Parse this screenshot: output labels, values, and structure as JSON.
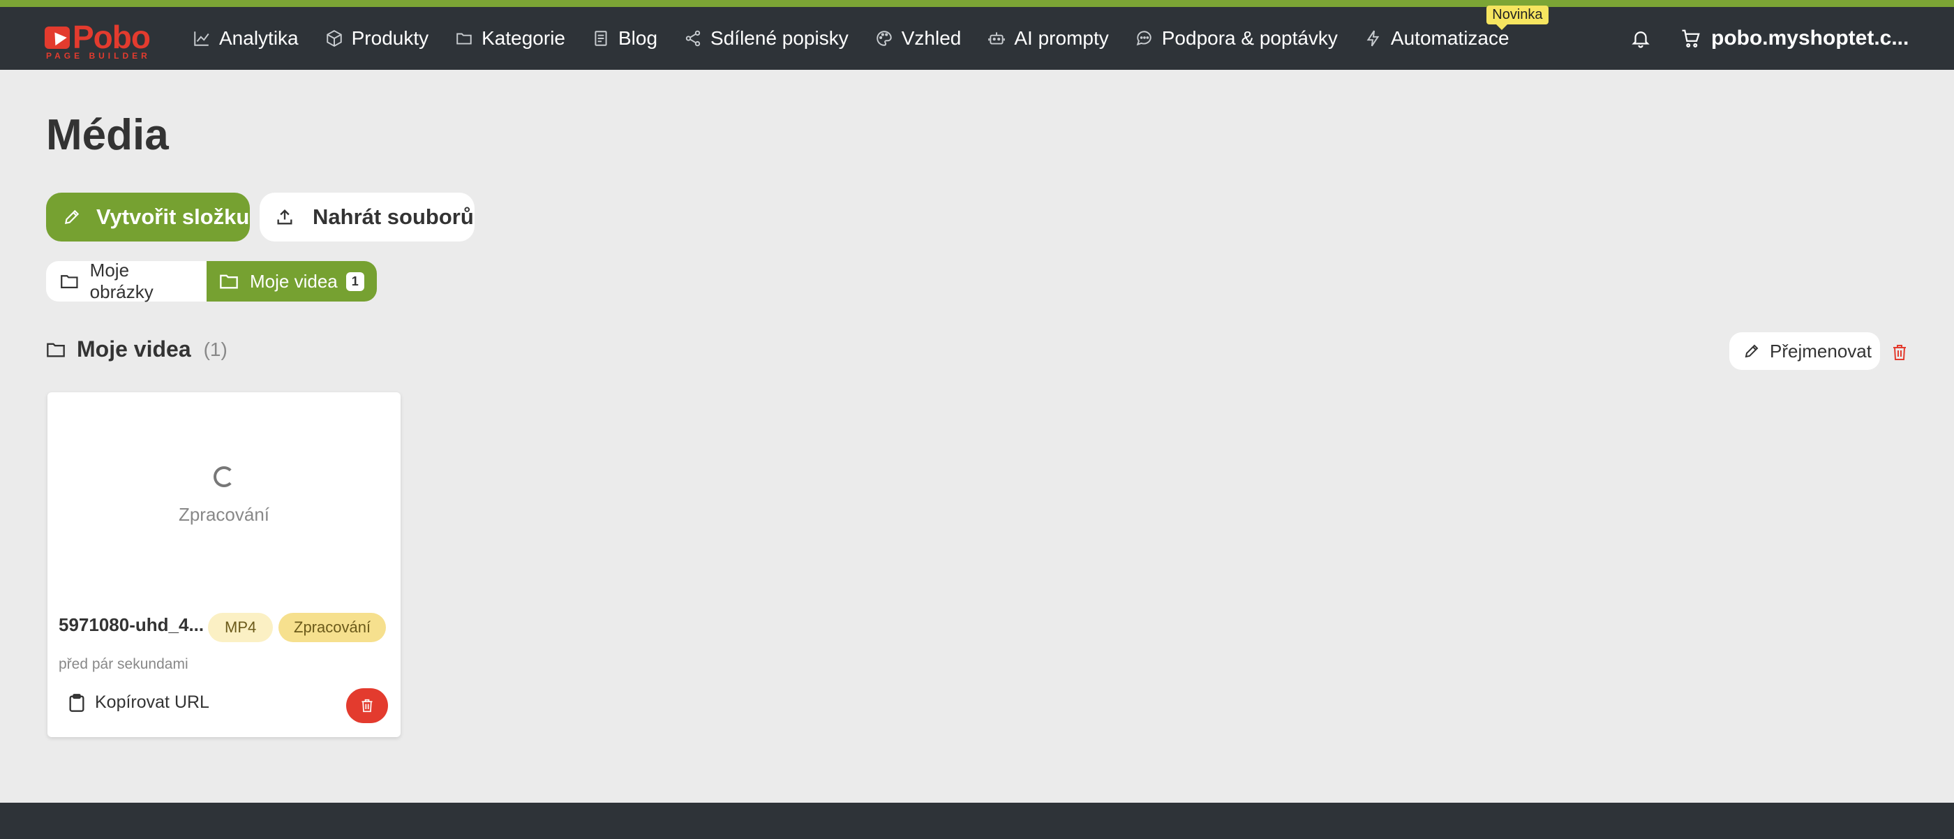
{
  "brand": {
    "logo_text": "Pobo",
    "logo_subtext": "PAGE BUILDER",
    "accent_color": "#76a131",
    "brand_color": "#e33b2e"
  },
  "nav": {
    "items": [
      {
        "label": "Analytika",
        "icon": "chart-line-icon"
      },
      {
        "label": "Produkty",
        "icon": "box-icon"
      },
      {
        "label": "Kategorie",
        "icon": "folder-icon"
      },
      {
        "label": "Blog",
        "icon": "document-icon"
      },
      {
        "label": "Sdílené popisky",
        "icon": "share-icon"
      },
      {
        "label": "Vzhled",
        "icon": "palette-icon"
      },
      {
        "label": "AI prompty",
        "icon": "robot-icon"
      },
      {
        "label": "Podpora & poptávky",
        "icon": "chat-icon"
      },
      {
        "label": "Automatizace",
        "icon": "bolt-icon",
        "badge": "Novinka"
      }
    ],
    "shop_name": "pobo.myshoptet.c..."
  },
  "page": {
    "title": "Média"
  },
  "actions": {
    "create_folder": "Vytvořit složku",
    "upload_files": "Nahrát souborů"
  },
  "folders": {
    "tabs": [
      {
        "label": "Moje obrázky",
        "active": false
      },
      {
        "label": "Moje videa",
        "active": true,
        "count": "1"
      }
    ]
  },
  "section": {
    "title": "Moje videa",
    "count": "(1)",
    "rename_label": "Přejmenovat"
  },
  "media": {
    "items": [
      {
        "status_text": "Zpracování",
        "name": "5971080-uhd_4...",
        "type_badge": "MP4",
        "status_badge": "Zpracování",
        "time": "před pár sekundami",
        "copy_label": "Kopírovat URL"
      }
    ]
  }
}
